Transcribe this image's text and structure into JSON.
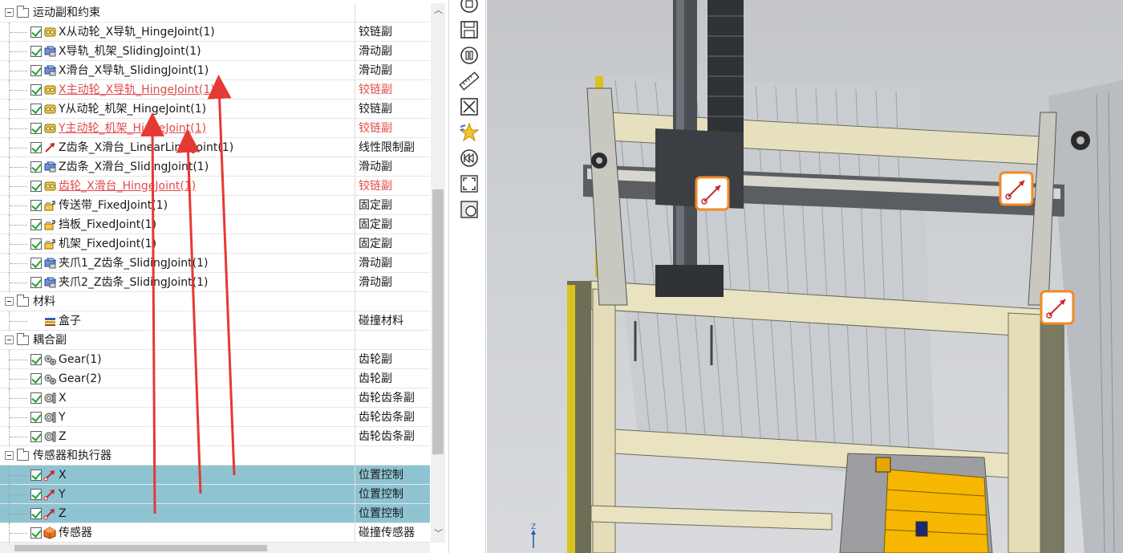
{
  "tree": {
    "groups": [
      {
        "label": "运动副和约束",
        "items": [
          {
            "name": "X从动轮_X导轨_HingeJoint(1)",
            "type": "铰链副",
            "icon": "hinge-joint-icon",
            "highlight": false,
            "selected": false
          },
          {
            "name": "X导轨_机架_SlidingJoint(1)",
            "type": "滑动副",
            "icon": "sliding-joint-icon",
            "highlight": false,
            "selected": false
          },
          {
            "name": "X滑台_X导轨_SlidingJoint(1)",
            "type": "滑动副",
            "icon": "sliding-joint-icon",
            "highlight": false,
            "selected": false
          },
          {
            "name": "X主动轮_X导轨_HingeJoint(1)",
            "type": "铰链副",
            "icon": "hinge-joint-icon",
            "highlight": true,
            "selected": false
          },
          {
            "name": "Y从动轮_机架_HingeJoint(1)",
            "type": "铰链副",
            "icon": "hinge-joint-icon",
            "highlight": false,
            "selected": false
          },
          {
            "name": "Y主动轮_机架_HingeJoint(1)",
            "type": "铰链副",
            "icon": "hinge-joint-icon",
            "highlight": true,
            "selected": false
          },
          {
            "name": "Z齿条_X滑台_LinearLimitJoint(1)",
            "type": "线性限制副",
            "icon": "limit-joint-icon",
            "highlight": false,
            "selected": false
          },
          {
            "name": "Z齿条_X滑台_SlidingJoint(1)",
            "type": "滑动副",
            "icon": "sliding-joint-icon",
            "highlight": false,
            "selected": false
          },
          {
            "name": "齿轮_X滑台_HingeJoint(1)",
            "type": "铰链副",
            "icon": "hinge-joint-icon",
            "highlight": true,
            "selected": false
          },
          {
            "name": "传送带_FixedJoint(1)",
            "type": "固定副",
            "icon": "fixed-joint-icon",
            "highlight": false,
            "selected": false
          },
          {
            "name": "挡板_FixedJoint(1)",
            "type": "固定副",
            "icon": "fixed-joint-icon",
            "highlight": false,
            "selected": false
          },
          {
            "name": "机架_FixedJoint(1)",
            "type": "固定副",
            "icon": "fixed-joint-icon",
            "highlight": false,
            "selected": false
          },
          {
            "name": "夹爪1_Z齿条_SlidingJoint(1)",
            "type": "滑动副",
            "icon": "sliding-joint-icon",
            "highlight": false,
            "selected": false
          },
          {
            "name": "夹爪2_Z齿条_SlidingJoint(1)",
            "type": "滑动副",
            "icon": "sliding-joint-icon",
            "highlight": false,
            "selected": false
          }
        ]
      },
      {
        "label": "材料",
        "items": [
          {
            "name": "盒子",
            "type": "碰撞材料",
            "icon": "collision-material-icon",
            "highlight": false,
            "selected": false,
            "nocheck": true
          }
        ]
      },
      {
        "label": "耦合副",
        "items": [
          {
            "name": "Gear(1)",
            "type": "齿轮副",
            "icon": "gear-icon",
            "highlight": false,
            "selected": false
          },
          {
            "name": "Gear(2)",
            "type": "齿轮副",
            "icon": "gear-icon",
            "highlight": false,
            "selected": false
          },
          {
            "name": "X",
            "type": "齿轮齿条副",
            "icon": "rack-pinion-icon",
            "highlight": false,
            "selected": false
          },
          {
            "name": "Y",
            "type": "齿轮齿条副",
            "icon": "rack-pinion-icon",
            "highlight": false,
            "selected": false
          },
          {
            "name": "Z",
            "type": "齿轮齿条副",
            "icon": "rack-pinion-icon",
            "highlight": false,
            "selected": false
          }
        ]
      },
      {
        "label": "传感器和执行器",
        "items": [
          {
            "name": "X",
            "type": "位置控制",
            "icon": "position-control-icon",
            "highlight": false,
            "selected": true
          },
          {
            "name": "Y",
            "type": "位置控制",
            "icon": "position-control-icon",
            "highlight": false,
            "selected": true
          },
          {
            "name": "Z",
            "type": "位置控制",
            "icon": "position-control-icon",
            "highlight": false,
            "selected": true
          },
          {
            "name": "传感器",
            "type": "碰撞传感器",
            "icon": "collision-sensor-icon",
            "highlight": false,
            "selected": false
          }
        ]
      }
    ]
  },
  "toolbar": {
    "buttons": [
      "circle-icon",
      "save-icon",
      "pause-icon",
      "ruler-icon",
      "close-box-icon",
      "star-icon",
      "rewind-icon",
      "fit-view-icon",
      "shade-icon"
    ]
  },
  "viewport": {
    "axis_label": "Z"
  },
  "colors": {
    "selection": "#8ec4d2",
    "highlight_text": "#e14b4b",
    "check": "#27a038",
    "annotation_arrow": "#e53935",
    "marker_border": "#f08a24"
  }
}
